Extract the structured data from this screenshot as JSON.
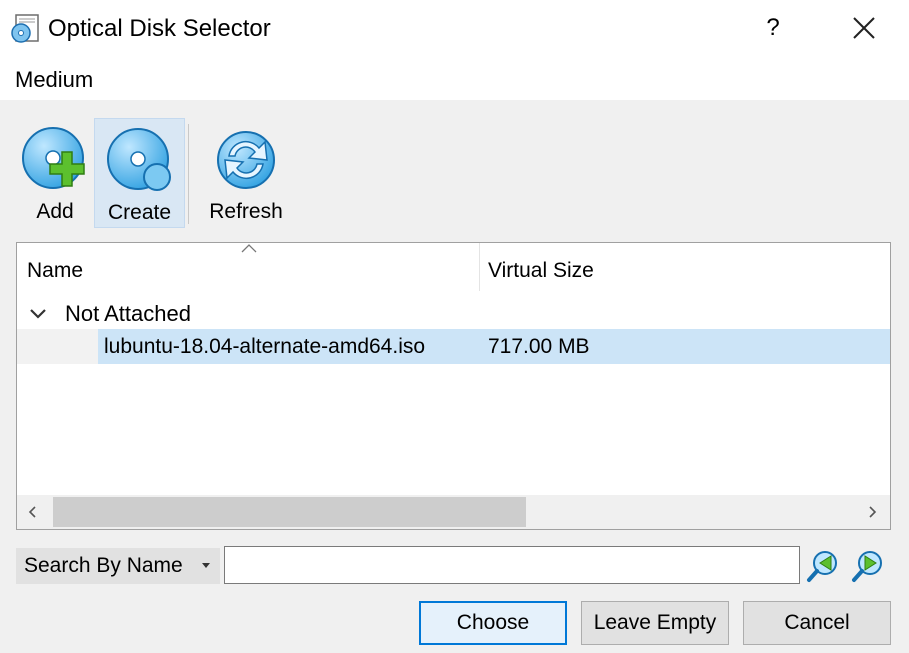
{
  "window": {
    "title": "Optical Disk Selector",
    "help_glyph": "?",
    "icons": {
      "app": "optical-disk-icon",
      "close": "close-icon"
    }
  },
  "menu": {
    "items": [
      {
        "label": "Medium"
      }
    ]
  },
  "toolbar": {
    "buttons": [
      {
        "label": "Add",
        "icon": "add-disk-icon",
        "active": false
      },
      {
        "label": "Create",
        "icon": "create-disk-icon",
        "active": true
      },
      {
        "label": "Refresh",
        "icon": "refresh-icon",
        "active": false
      }
    ]
  },
  "media_list": {
    "columns": [
      {
        "label": "Name",
        "sorted": "ascending"
      },
      {
        "label": "Virtual Size"
      }
    ],
    "groups": [
      {
        "label": "Not Attached",
        "expanded": true,
        "items": [
          {
            "name": "lubuntu-18.04-alternate-amd64.iso",
            "virtual_size": "717.00 MB",
            "selected": true
          }
        ]
      }
    ]
  },
  "search": {
    "type_selected": "Search By Name",
    "value": "",
    "icons": {
      "previous": "search-previous-icon",
      "next": "search-next-icon"
    }
  },
  "buttons": {
    "choose": "Choose",
    "leave_empty": "Leave Empty",
    "cancel": "Cancel"
  },
  "colors": {
    "selection": "#cce4f7",
    "active_toolbar": "#d9e7f4",
    "default_button_border": "#0078d7",
    "icon_blue": "#35a8e6",
    "icon_green": "#5cc02e"
  }
}
